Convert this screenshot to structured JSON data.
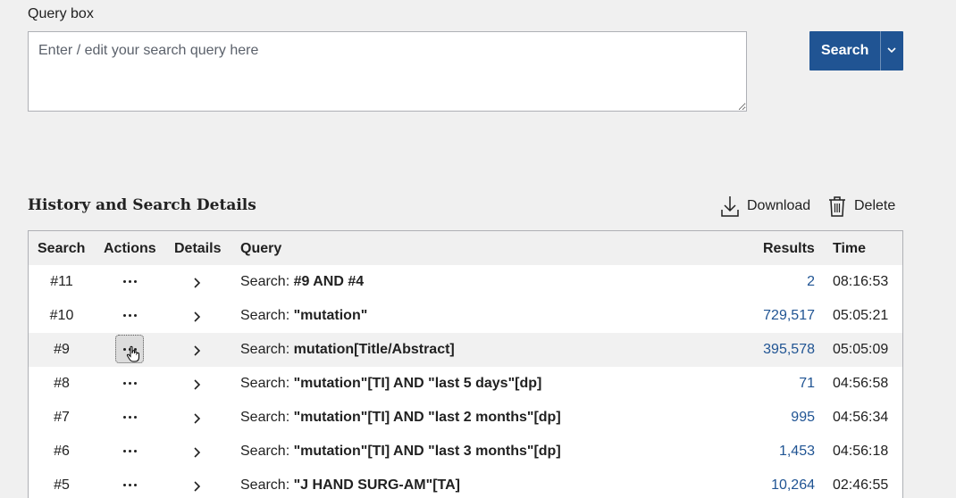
{
  "query": {
    "label": "Query box",
    "placeholder": "Enter / edit your search query here",
    "value": ""
  },
  "search_button": {
    "label": "Search"
  },
  "history": {
    "title": "History and Search Details",
    "download_label": "Download",
    "delete_label": "Delete",
    "columns": {
      "search": "Search",
      "actions": "Actions",
      "details": "Details",
      "query": "Query",
      "results": "Results",
      "time": "Time"
    },
    "rows": [
      {
        "id": "#11",
        "prefix": "Search: ",
        "query": "#9 AND #4",
        "results": "2",
        "time": "08:16:53"
      },
      {
        "id": "#10",
        "prefix": "Search: ",
        "query": "\"mutation\"",
        "results": "729,517",
        "time": "05:05:21"
      },
      {
        "id": "#9",
        "prefix": "Search: ",
        "query": "mutation[Title/Abstract]",
        "results": "395,578",
        "time": "05:05:09"
      },
      {
        "id": "#8",
        "prefix": "Search: ",
        "query": "\"mutation\"[TI] AND \"last 5 days\"[dp]",
        "results": "71",
        "time": "04:56:58"
      },
      {
        "id": "#7",
        "prefix": "Search: ",
        "query": "\"mutation\"[TI] AND \"last 2 months\"[dp]",
        "results": "995",
        "time": "04:56:34"
      },
      {
        "id": "#6",
        "prefix": "Search: ",
        "query": "\"mutation\"[TI] AND \"last 3 months\"[dp]",
        "results": "1,453",
        "time": "04:56:18"
      },
      {
        "id": "#5",
        "prefix": "Search: ",
        "query": "\"J HAND SURG-AM\"[TA]",
        "results": "10,264",
        "time": "02:46:55"
      }
    ]
  },
  "colors": {
    "accent": "#205493",
    "link": "#205493",
    "text": "#212121"
  }
}
